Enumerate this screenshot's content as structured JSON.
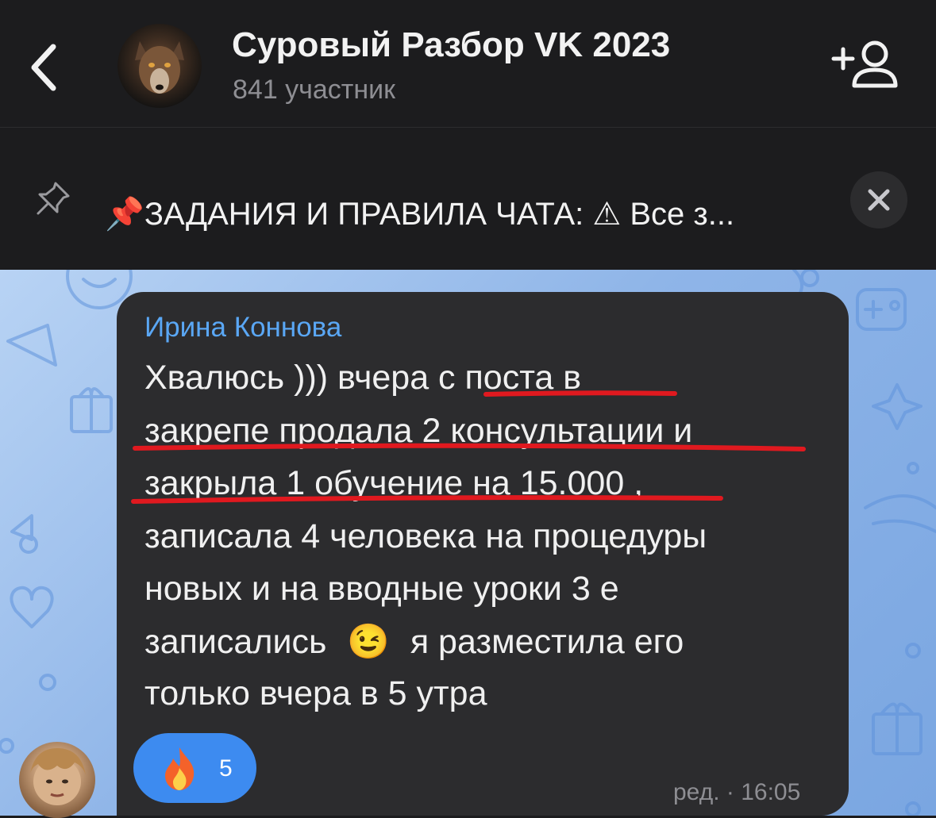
{
  "header": {
    "title": "Суровый Разбор VK 2023",
    "subtitle": "841 участник",
    "icons": {
      "back": "chevron-left-icon",
      "add_member": "add-person-icon"
    }
  },
  "pinned": {
    "emoji": "📌",
    "text": "ЗАДАНИЯ И ПРАВИЛА ЧАТА: ⚠ Все з...",
    "icons": {
      "pin": "pin-icon",
      "close": "close-icon"
    }
  },
  "message": {
    "sender": "Ирина Коннова",
    "lines": [
      "Хвалюсь ))) вчера с поста в",
      "закрепе продала 2 консультации и",
      "закрыла 1 обучение на 15.000 ,",
      "записала 4 человека на процедуры",
      "новых и на вводные уроки 3 е",
      "записались",
      "я разместила его",
      "только вчера в 5 утра"
    ],
    "emoji": "😉",
    "reaction": {
      "emoji": "🔥",
      "count": "5"
    },
    "meta": "ред. · 16:05"
  },
  "colors": {
    "accent": "#3d8bf0",
    "sender_name": "#5aa7f5",
    "underline": "#e0191f",
    "bubble": "#2c2c2e",
    "header_bg": "#1c1c1e"
  }
}
